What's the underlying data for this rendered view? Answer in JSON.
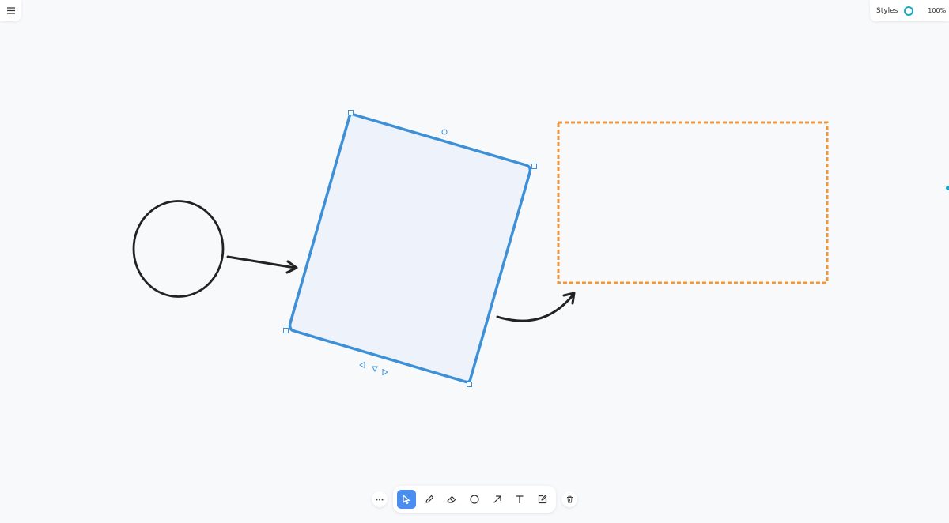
{
  "header": {
    "menu_icon": "hamburger-menu-icon",
    "styles_label": "Styles",
    "style_color": "#1aa7c4",
    "zoom_label": "100%"
  },
  "toolbar": {
    "more_icon": "more-horizontal-icon",
    "tools": [
      {
        "name": "select",
        "icon": "cursor-icon",
        "active": true
      },
      {
        "name": "draw",
        "icon": "pencil-icon",
        "active": false
      },
      {
        "name": "eraser",
        "icon": "eraser-icon",
        "active": false
      },
      {
        "name": "ellipse",
        "icon": "circle-icon",
        "active": false
      },
      {
        "name": "arrow",
        "icon": "arrow-icon",
        "active": false
      },
      {
        "name": "text",
        "icon": "text-icon",
        "active": false
      },
      {
        "name": "note",
        "icon": "edit-note-icon",
        "active": false
      }
    ],
    "delete_icon": "trash-icon",
    "active_color": "#4a8df0"
  },
  "canvas": {
    "shapes": [
      {
        "type": "ellipse",
        "stroke": "#222222"
      },
      {
        "type": "arrow",
        "stroke": "#222222"
      },
      {
        "type": "rectangle",
        "selected": true,
        "stroke": "#3d8fd6",
        "fill": "#eef3fb"
      },
      {
        "type": "curved-arrow",
        "stroke": "#222222"
      },
      {
        "type": "rectangle",
        "style": "dashed",
        "stroke": "#f0973a"
      }
    ]
  }
}
